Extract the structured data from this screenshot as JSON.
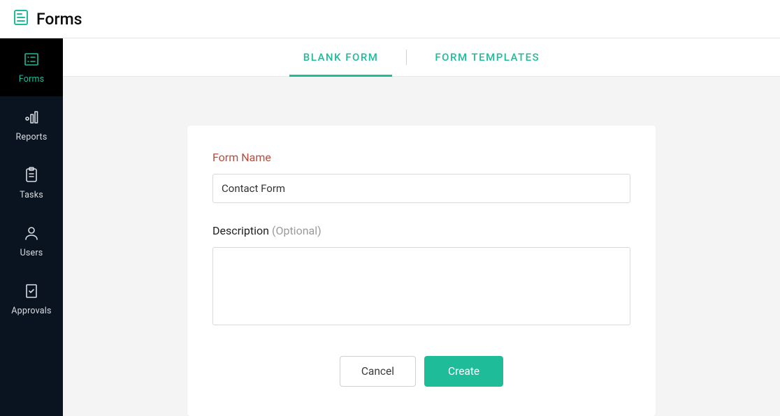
{
  "header": {
    "title": "Forms"
  },
  "sidebar": {
    "items": [
      {
        "label": "Forms",
        "icon": "forms-icon",
        "active": true
      },
      {
        "label": "Reports",
        "icon": "reports-icon",
        "active": false
      },
      {
        "label": "Tasks",
        "icon": "tasks-icon",
        "active": false
      },
      {
        "label": "Users",
        "icon": "users-icon",
        "active": false
      },
      {
        "label": "Approvals",
        "icon": "approvals-icon",
        "active": false
      }
    ]
  },
  "tabs": {
    "items": [
      {
        "label": "BLANK FORM",
        "active": true
      },
      {
        "label": "FORM TEMPLATES",
        "active": false
      }
    ]
  },
  "form": {
    "name_label": "Form Name",
    "name_value": "Contact Form",
    "description_label": "Description",
    "description_hint": "(Optional)",
    "description_value": ""
  },
  "buttons": {
    "cancel": "Cancel",
    "create": "Create"
  },
  "colors": {
    "accent": "#1fbc9a",
    "sidebar_bg": "#0a1320",
    "error_label": "#b84c3d"
  }
}
